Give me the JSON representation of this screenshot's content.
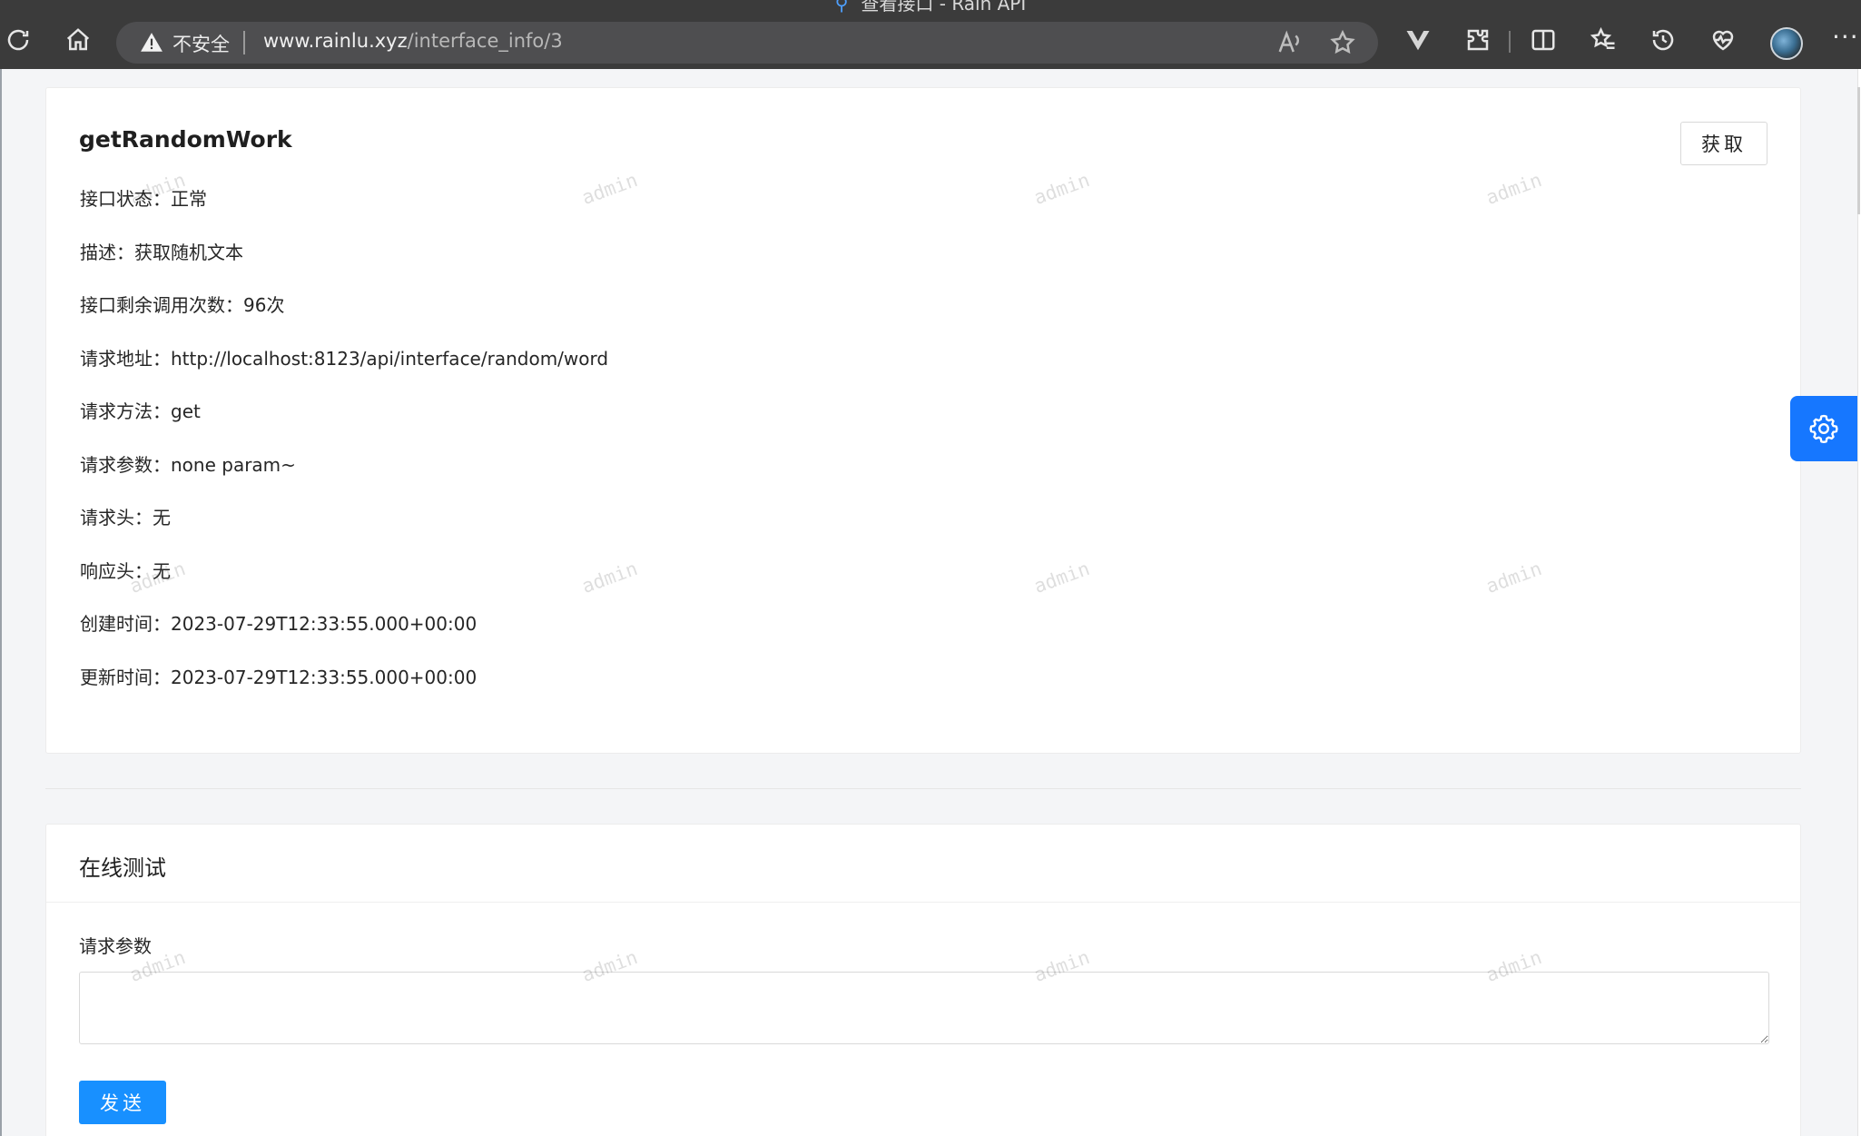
{
  "browser": {
    "tab_title": "查看接口 - Rain API",
    "security_label": "不安全",
    "url_host": "www.rainlu.xyz",
    "url_path": "/interface_info/3",
    "menu_label": "···"
  },
  "interface": {
    "name": "getRandomWork",
    "fetch_button": "获取",
    "details": [
      "接口状态：正常",
      "描述：获取随机文本",
      "接口剩余调用次数：96次",
      "请求地址：http://localhost:8123/api/interface/random/word",
      "请求方法：get",
      "请求参数：none param~",
      "请求头：无",
      "响应头：无",
      "创建时间：2023-07-29T12:33:55.000+00:00",
      "更新时间：2023-07-29T12:33:55.000+00:00"
    ]
  },
  "online_test": {
    "title": "在线测试",
    "param_label": "请求参数",
    "param_value": "",
    "send_button": "发送"
  },
  "watermark": {
    "text": "admin"
  },
  "colors": {
    "primary": "#1890ff",
    "settings_fab": "#1677ff",
    "chrome_bg": "#3b3b3b"
  }
}
